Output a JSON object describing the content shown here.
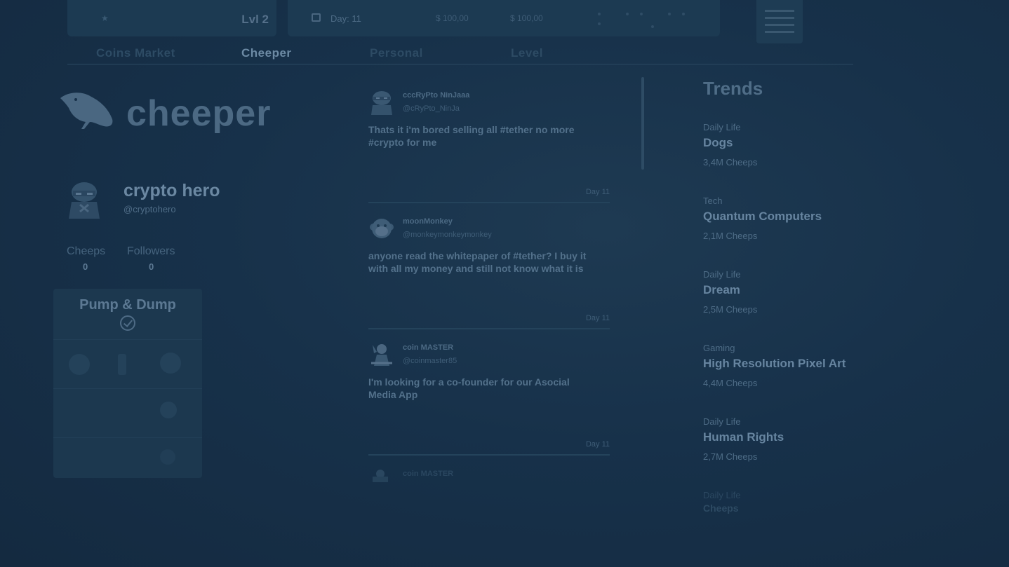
{
  "hud": {
    "level_label": "Lvl 2",
    "day_label": "Day: 11",
    "money_1": "$ 100,00",
    "money_2": "$ 100,00"
  },
  "tabs": [
    {
      "label": "Coins Market",
      "active": false
    },
    {
      "label": "Cheeper",
      "active": true
    },
    {
      "label": "Personal",
      "active": false
    },
    {
      "label": "Level",
      "active": false
    }
  ],
  "brand": {
    "wordmark": "cheeper"
  },
  "profile": {
    "name": "crypto hero",
    "handle": "@cryptohero",
    "cheeps_label": "Cheeps",
    "cheeps_value": "0",
    "followers_label": "Followers",
    "followers_value": "0"
  },
  "pump_dump": {
    "title": "Pump & Dump"
  },
  "feed": [
    {
      "author": "cccRyPto NinJaaa",
      "handle": "@cRyPto_NinJa",
      "text": "Thats it i'm bored selling all #tether no more #crypto for me",
      "date": "Day 11"
    },
    {
      "author": "moonMonkey",
      "handle": "@monkeymonkeymonkey",
      "text": "anyone read the whitepaper of #tether? I buy it with all my money and still not know what it is",
      "date": "Day 11"
    },
    {
      "author": "coin MASTER",
      "handle": "@coinmaster85",
      "text": "I'm looking for a co-founder for our Asocial Media App",
      "date": "Day 11"
    },
    {
      "author": "coin MASTER"
    }
  ],
  "trends": {
    "title": "Trends",
    "items": [
      {
        "category": "Daily Life",
        "topic": "Dogs",
        "count": "3,4M Cheeps"
      },
      {
        "category": "Tech",
        "topic": "Quantum Computers",
        "count": "2,1M Cheeps"
      },
      {
        "category": "Daily Life",
        "topic": "Dream",
        "count": "2,5M Cheeps"
      },
      {
        "category": "Gaming",
        "topic": "High Resolution Pixel Art",
        "count": "4,4M Cheeps"
      },
      {
        "category": "Daily Life",
        "topic": "Human Rights",
        "count": "2,7M Cheeps"
      },
      {
        "category": "Daily Life",
        "topic": "Cheeps",
        "count": ""
      }
    ]
  },
  "colors": {
    "background": "#17314a",
    "panel": "#1c3a52",
    "text_bright": "#6b88a2",
    "text_dim": "#3f5d77"
  }
}
